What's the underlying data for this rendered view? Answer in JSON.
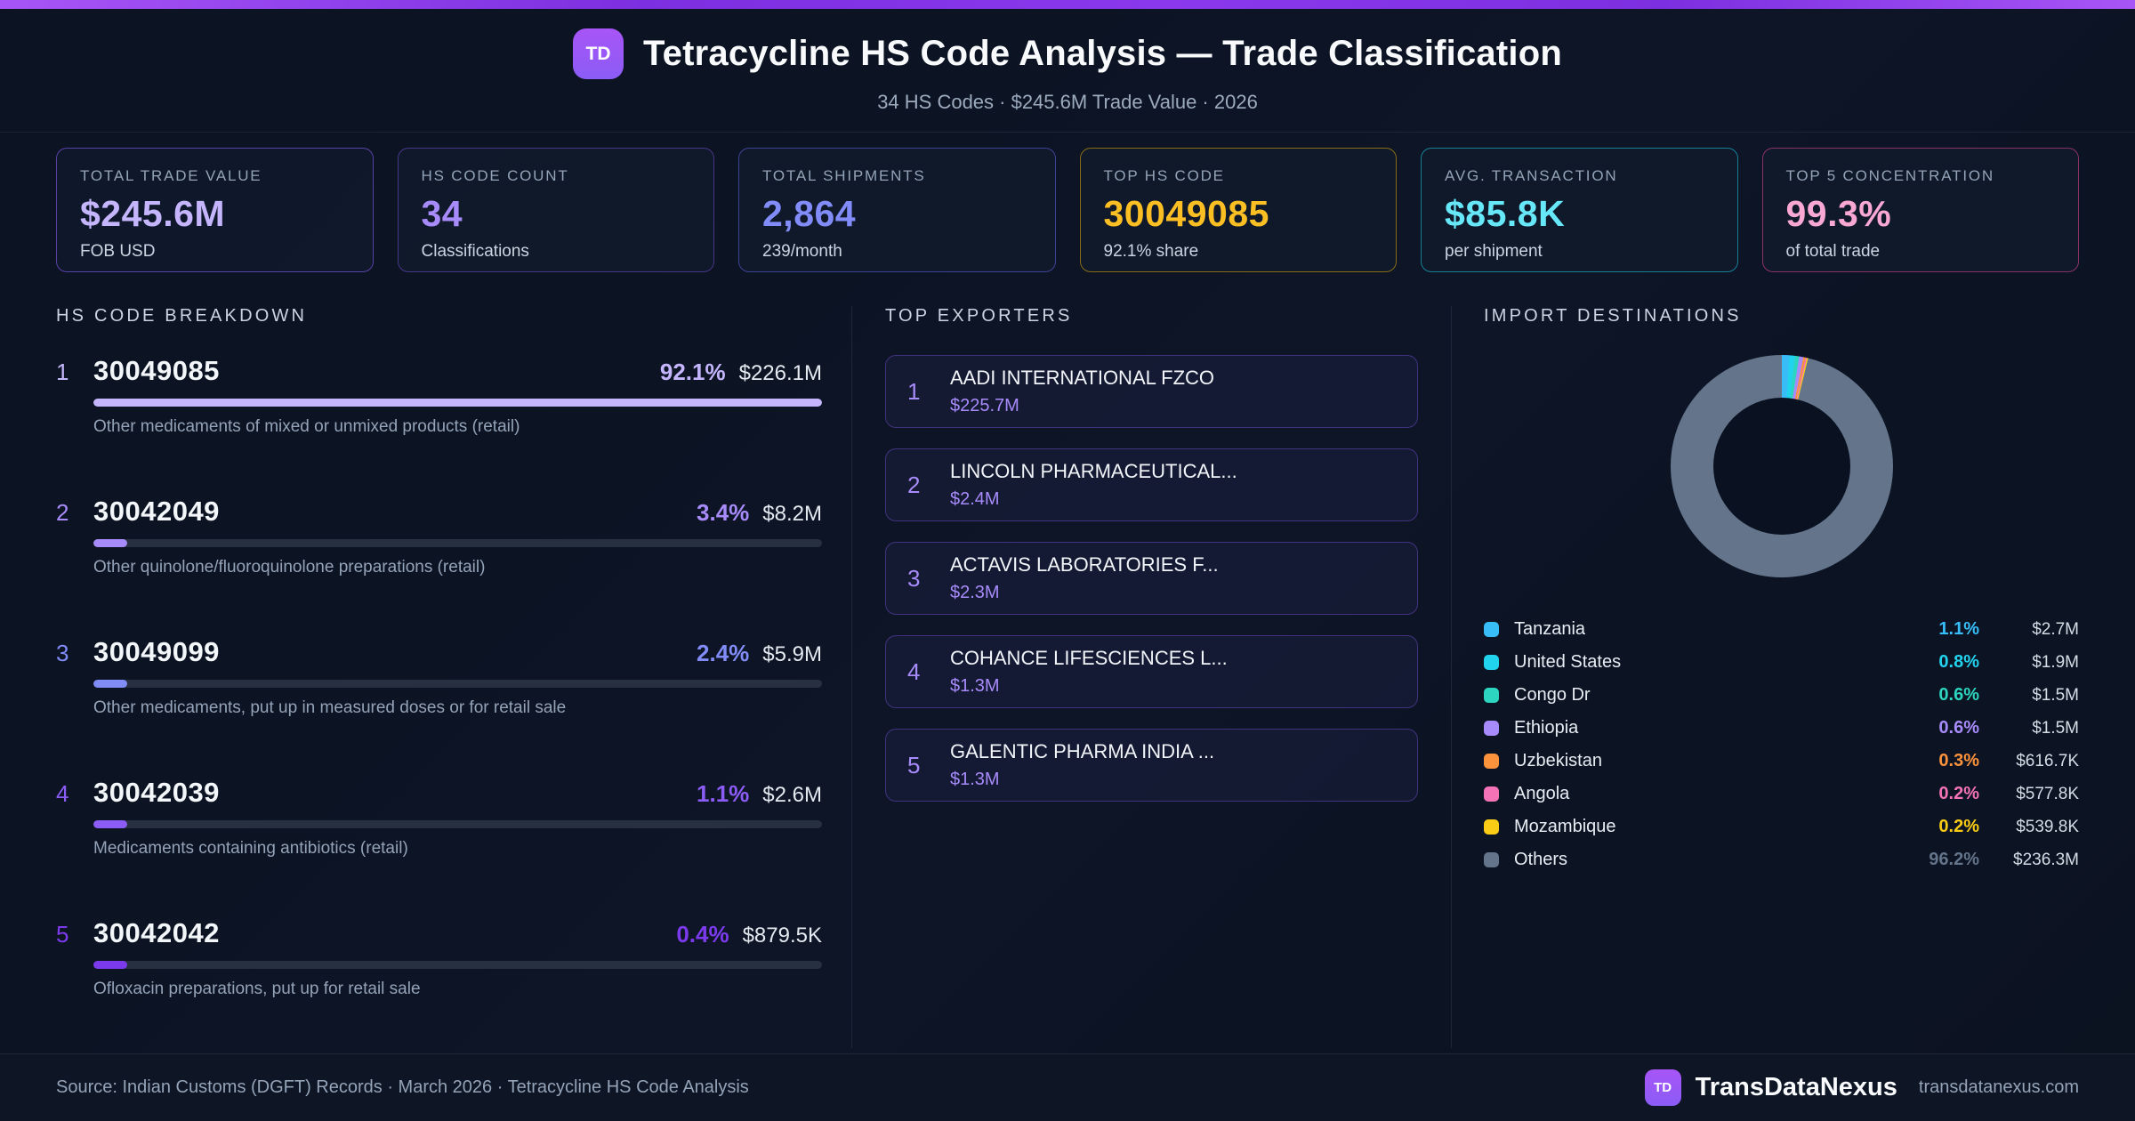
{
  "header": {
    "logo": "TD",
    "title": "Tetracycline HS Code Analysis — Trade Classification",
    "subtitle": "34 HS Codes · $245.6M Trade Value · 2026"
  },
  "stats": [
    {
      "label": "TOTAL TRADE VALUE",
      "value": "$245.6M",
      "sub": "FOB USD",
      "accent": "#c4b5fd",
      "border": "rgba(139,92,246,0.60)"
    },
    {
      "label": "HS CODE COUNT",
      "value": "34",
      "sub": "Classifications",
      "accent": "#a78bfa",
      "border": "rgba(139,92,246,0.45)"
    },
    {
      "label": "TOTAL SHIPMENTS",
      "value": "2,864",
      "sub": "239/month",
      "accent": "#818cf8",
      "border": "rgba(99,102,241,0.55)"
    },
    {
      "label": "TOP HS CODE",
      "value": "30049085",
      "sub": "92.1% share",
      "accent": "#fbbf24",
      "border": "rgba(234,179,8,0.55)"
    },
    {
      "label": "AVG. TRANSACTION",
      "value": "$85.8K",
      "sub": "per shipment",
      "accent": "#67e8f9",
      "border": "rgba(34,211,238,0.55)"
    },
    {
      "label": "TOP 5 CONCENTRATION",
      "value": "99.3%",
      "sub": "of total trade",
      "accent": "#f9a8d4",
      "border": "rgba(236,72,153,0.55)"
    }
  ],
  "breakdown": {
    "title": "HS CODE BREAKDOWN",
    "rows": [
      {
        "rank": "1",
        "code": "30049085",
        "pct": "92.1%",
        "value": "$226.1M",
        "desc": "Other medicaments of mixed or unmixed products (retail)",
        "color": "#c4b5fd"
      },
      {
        "rank": "2",
        "code": "30042049",
        "pct": "3.4%",
        "value": "$8.2M",
        "desc": "Other quinolone/fluoroquinolone preparations (retail)",
        "color": "#a78bfa"
      },
      {
        "rank": "3",
        "code": "30049099",
        "pct": "2.4%",
        "value": "$5.9M",
        "desc": "Other medicaments, put up in measured doses or for retail sale",
        "color": "#818cf8"
      },
      {
        "rank": "4",
        "code": "30042039",
        "pct": "1.1%",
        "value": "$2.6M",
        "desc": "Medicaments containing antibiotics (retail)",
        "color": "#8b5cf6"
      },
      {
        "rank": "5",
        "code": "30042042",
        "pct": "0.4%",
        "value": "$879.5K",
        "desc": "Ofloxacin preparations, put up for retail sale",
        "color": "#7c3aed"
      }
    ]
  },
  "exporters": {
    "title": "TOP EXPORTERS",
    "items": [
      {
        "rank": "1",
        "name": "AADI INTERNATIONAL FZCO",
        "value": "$225.7M"
      },
      {
        "rank": "2",
        "name": "LINCOLN PHARMACEUTICAL...",
        "value": "$2.4M"
      },
      {
        "rank": "3",
        "name": "ACTAVIS LABORATORIES F...",
        "value": "$2.3M"
      },
      {
        "rank": "4",
        "name": "COHANCE LIFESCIENCES L...",
        "value": "$1.3M"
      },
      {
        "rank": "5",
        "name": "GALENTIC PHARMA INDIA ...",
        "value": "$1.3M"
      }
    ]
  },
  "destinations": {
    "title": "IMPORT DESTINATIONS"
  },
  "chart_data": [
    {
      "type": "pie",
      "donut": true,
      "title": "IMPORT DESTINATIONS",
      "labels": [
        "Tanzania",
        "United States",
        "Congo Dr",
        "Ethiopia",
        "Uzbekistan",
        "Angola",
        "Mozambique",
        "Others"
      ],
      "values_pct": [
        1.1,
        0.8,
        0.6,
        0.6,
        0.3,
        0.2,
        0.2,
        96.2
      ],
      "values_usd": [
        "$2.7M",
        "$1.9M",
        "$1.5M",
        "$1.5M",
        "$616.7K",
        "$577.8K",
        "$539.8K",
        "$236.3M"
      ],
      "colors": [
        "#38bdf8",
        "#22d3ee",
        "#2dd4bf",
        "#a78bfa",
        "#fb923c",
        "#f472b6",
        "#facc15",
        "#64748b"
      ],
      "legend_position": "bottom",
      "start_angle_deg": 0,
      "direction": "clockwise"
    },
    {
      "type": "bar",
      "title": "HS CODE BREAKDOWN",
      "categories": [
        "30049085",
        "30042049",
        "30049099",
        "30042039",
        "30042042"
      ],
      "values_pct": [
        92.1,
        3.4,
        2.4,
        1.1,
        0.4
      ],
      "values_usd": [
        "$226.1M",
        "$8.2M",
        "$5.9M",
        "$2.6M",
        "$879.5K"
      ],
      "orientation": "horizontal",
      "xlim": [
        0,
        92.1
      ]
    }
  ],
  "footer": {
    "source": "Source: Indian Customs (DGFT) Records · March 2026 · Tetracycline HS Code Analysis",
    "logo": "TD",
    "brand": "TransDataNexus",
    "domain": "transdatanexus.com"
  }
}
